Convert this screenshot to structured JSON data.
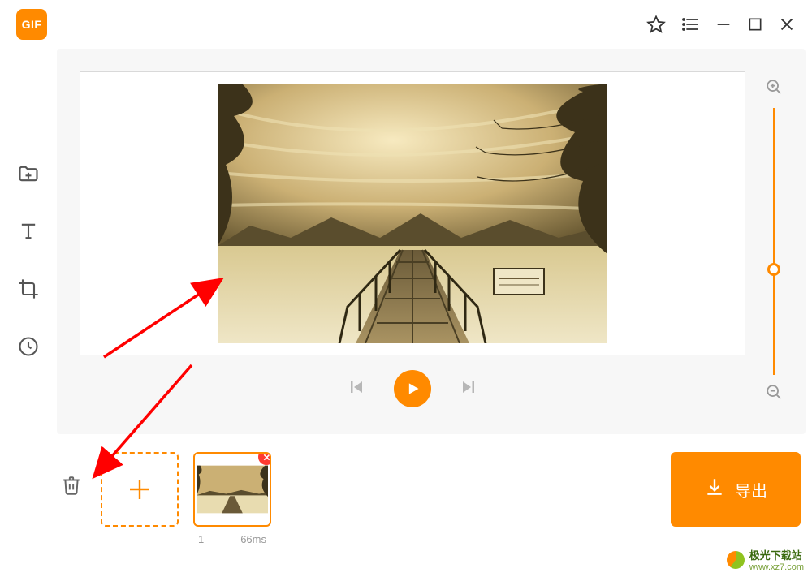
{
  "app": {
    "logo_text": "GIF"
  },
  "titlebar": {
    "star_icon": "favorite-icon",
    "list_icon": "list-icon",
    "min_icon": "minimize-icon",
    "max_icon": "maximize-icon",
    "close_icon": "close-icon"
  },
  "sidebar": {
    "tools": [
      {
        "id": "add-file",
        "label": "Add file"
      },
      {
        "id": "text",
        "label": "Text"
      },
      {
        "id": "crop",
        "label": "Crop"
      },
      {
        "id": "duration",
        "label": "Duration"
      }
    ]
  },
  "playback": {
    "prev_icon": "prev-frame-icon",
    "play_icon": "play-icon",
    "next_icon": "next-frame-icon"
  },
  "zoom": {
    "in_icon": "zoom-in-icon",
    "out_icon": "zoom-out-icon"
  },
  "frames": {
    "trash_icon": "trash-icon",
    "add_icon": "add-frame-icon",
    "items": [
      {
        "index": "1",
        "duration": "66ms"
      }
    ]
  },
  "export": {
    "label": "导出",
    "icon": "download-icon"
  },
  "watermark": {
    "text": "极光下载站",
    "url": "www.xz7.com"
  },
  "colors": {
    "accent": "#ff8a00",
    "danger": "#ff3a30"
  }
}
